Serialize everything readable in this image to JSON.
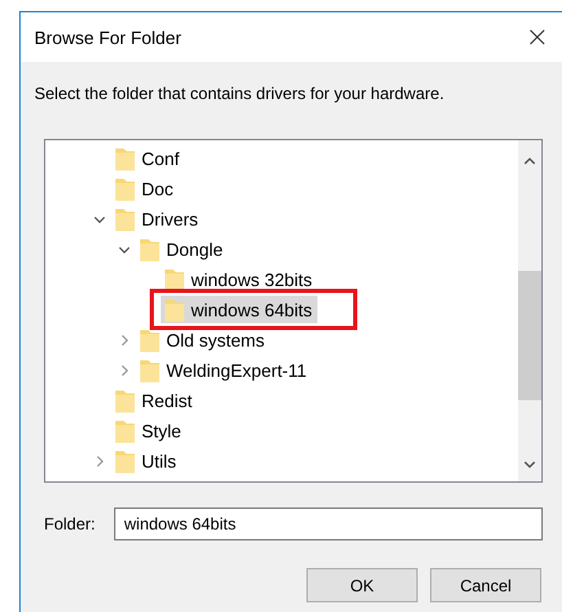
{
  "window": {
    "title": "Browse For Folder"
  },
  "instruction": "Select the folder that contains drivers for your hardware.",
  "tree": [
    {
      "label": "Conf",
      "kind": "leaf",
      "selected": false
    },
    {
      "label": "Doc",
      "kind": "leaf",
      "selected": false
    },
    {
      "label": "Drivers",
      "kind": "branch",
      "expanded": true,
      "selected": false,
      "children": [
        {
          "label": "Dongle",
          "kind": "branch",
          "expanded": true,
          "selected": false,
          "children": [
            {
              "label": "windows 32bits",
              "kind": "leaf",
              "selected": false
            },
            {
              "label": "windows 64bits",
              "kind": "leaf",
              "selected": true
            }
          ]
        },
        {
          "label": "Old systems",
          "kind": "branch",
          "expanded": false,
          "selected": false
        },
        {
          "label": "WeldingExpert-11",
          "kind": "branch",
          "expanded": false,
          "selected": false
        }
      ]
    },
    {
      "label": "Redist",
      "kind": "leaf",
      "selected": false
    },
    {
      "label": "Style",
      "kind": "leaf",
      "selected": false
    },
    {
      "label": "Utils",
      "kind": "branch",
      "expanded": false,
      "selected": false
    }
  ],
  "folder": {
    "label": "Folder:",
    "value": "windows 64bits"
  },
  "buttons": [
    "OK",
    "Cancel"
  ]
}
